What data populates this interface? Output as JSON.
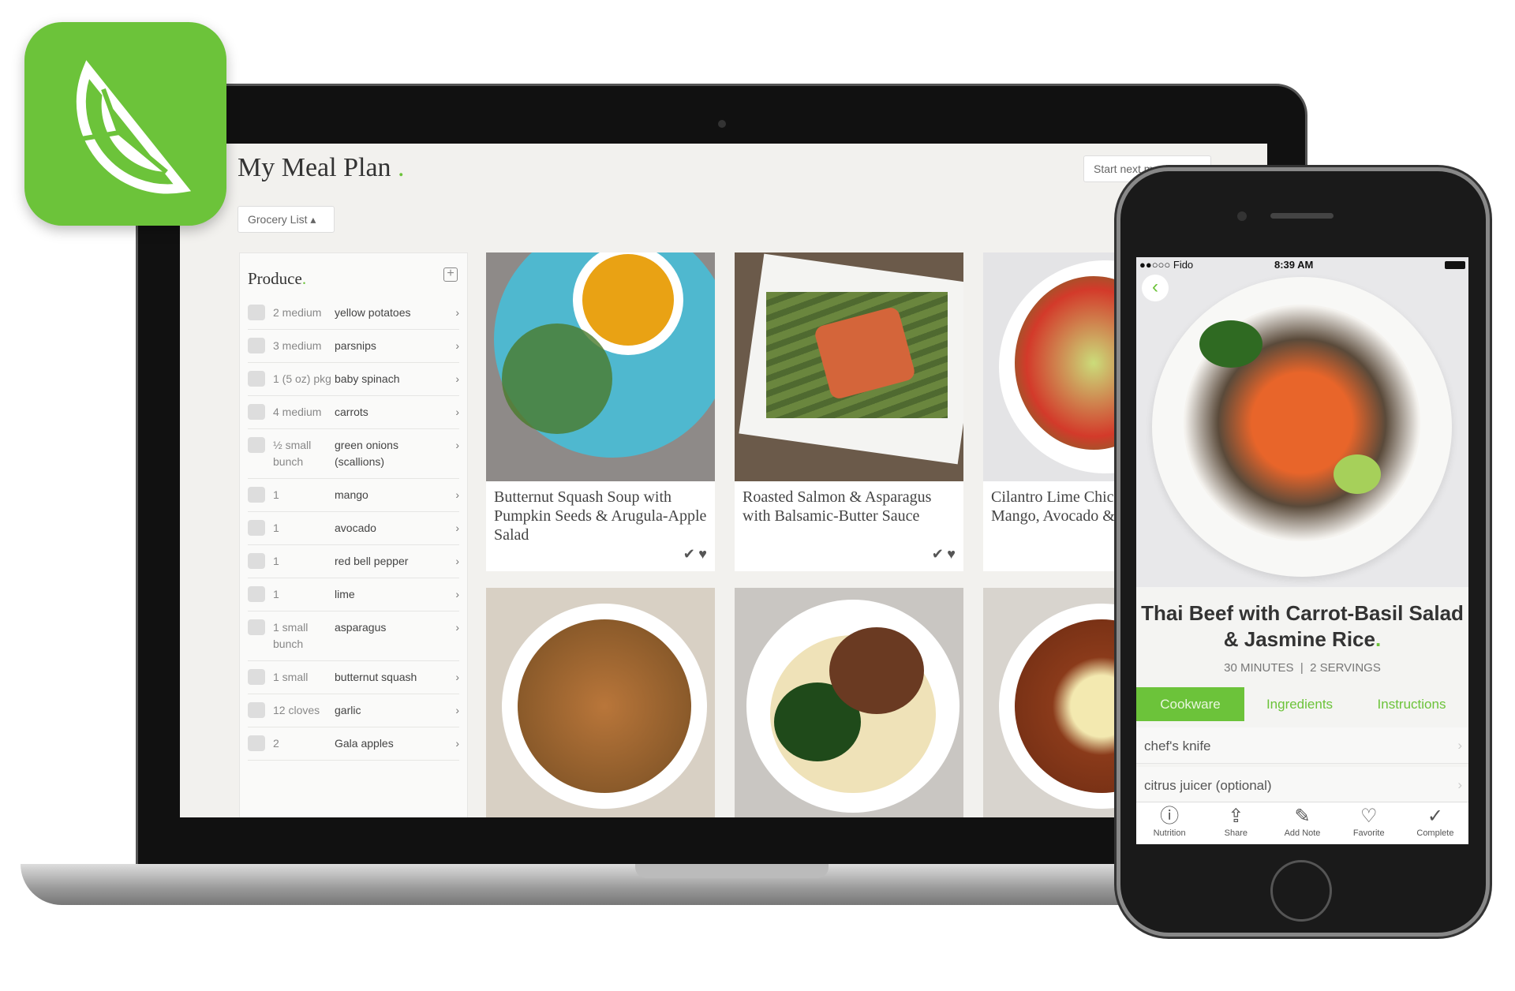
{
  "brand": {
    "accent": "#6cc33a",
    "logo": "lime-slice-logo"
  },
  "laptop": {
    "page_title": "My Meal Plan",
    "title_dot": ".",
    "start_button": "Start next meal plan",
    "grocery_button": "Grocery List ▴",
    "grocery": {
      "section": "Produce",
      "items": [
        {
          "qty": "2 medium",
          "name": "yellow potatoes"
        },
        {
          "qty": "3 medium",
          "name": "parsnips"
        },
        {
          "qty": "1 (5 oz) pkg",
          "name": "baby spinach"
        },
        {
          "qty": "4 medium",
          "name": "carrots"
        },
        {
          "qty": "½ small bunch",
          "name": "green onions (scallions)"
        },
        {
          "qty": "1",
          "name": "mango"
        },
        {
          "qty": "1",
          "name": "avocado"
        },
        {
          "qty": "1",
          "name": "red bell pepper"
        },
        {
          "qty": "1",
          "name": "lime"
        },
        {
          "qty": "1 small bunch",
          "name": "asparagus"
        },
        {
          "qty": "1 small",
          "name": "butternut squash"
        },
        {
          "qty": "12 cloves",
          "name": "garlic"
        },
        {
          "qty": "2",
          "name": "Gala apples"
        }
      ]
    },
    "recipes": [
      {
        "title": "Butternut Squash Soup with Pumpkin Seeds & Arugula-Apple Salad"
      },
      {
        "title": "Roasted Salmon & Asparagus with Balsamic-Butter Sauce"
      },
      {
        "title": "Cilantro Lime Chicken with Mango, Avocado & Pepper"
      }
    ]
  },
  "phone": {
    "carrier": "●●○○○ Fido",
    "time": "8:39 AM",
    "recipe_title": "Thai Beef with Carrot-Basil Salad & Jasmine Rice",
    "meta": "30 MINUTES  |  2 SERVINGS",
    "tabs": [
      "Cookware",
      "Ingredients",
      "Instructions"
    ],
    "active_tab": "Cookware",
    "cookware": [
      "chef's knife",
      "citrus juicer (optional)"
    ],
    "toolbar": [
      {
        "label": "Nutrition",
        "icon": "info-icon"
      },
      {
        "label": "Share",
        "icon": "share-icon"
      },
      {
        "label": "Add Note",
        "icon": "edit-icon"
      },
      {
        "label": "Favorite",
        "icon": "heart-icon"
      },
      {
        "label": "Complete",
        "icon": "check-circle-icon"
      }
    ]
  }
}
